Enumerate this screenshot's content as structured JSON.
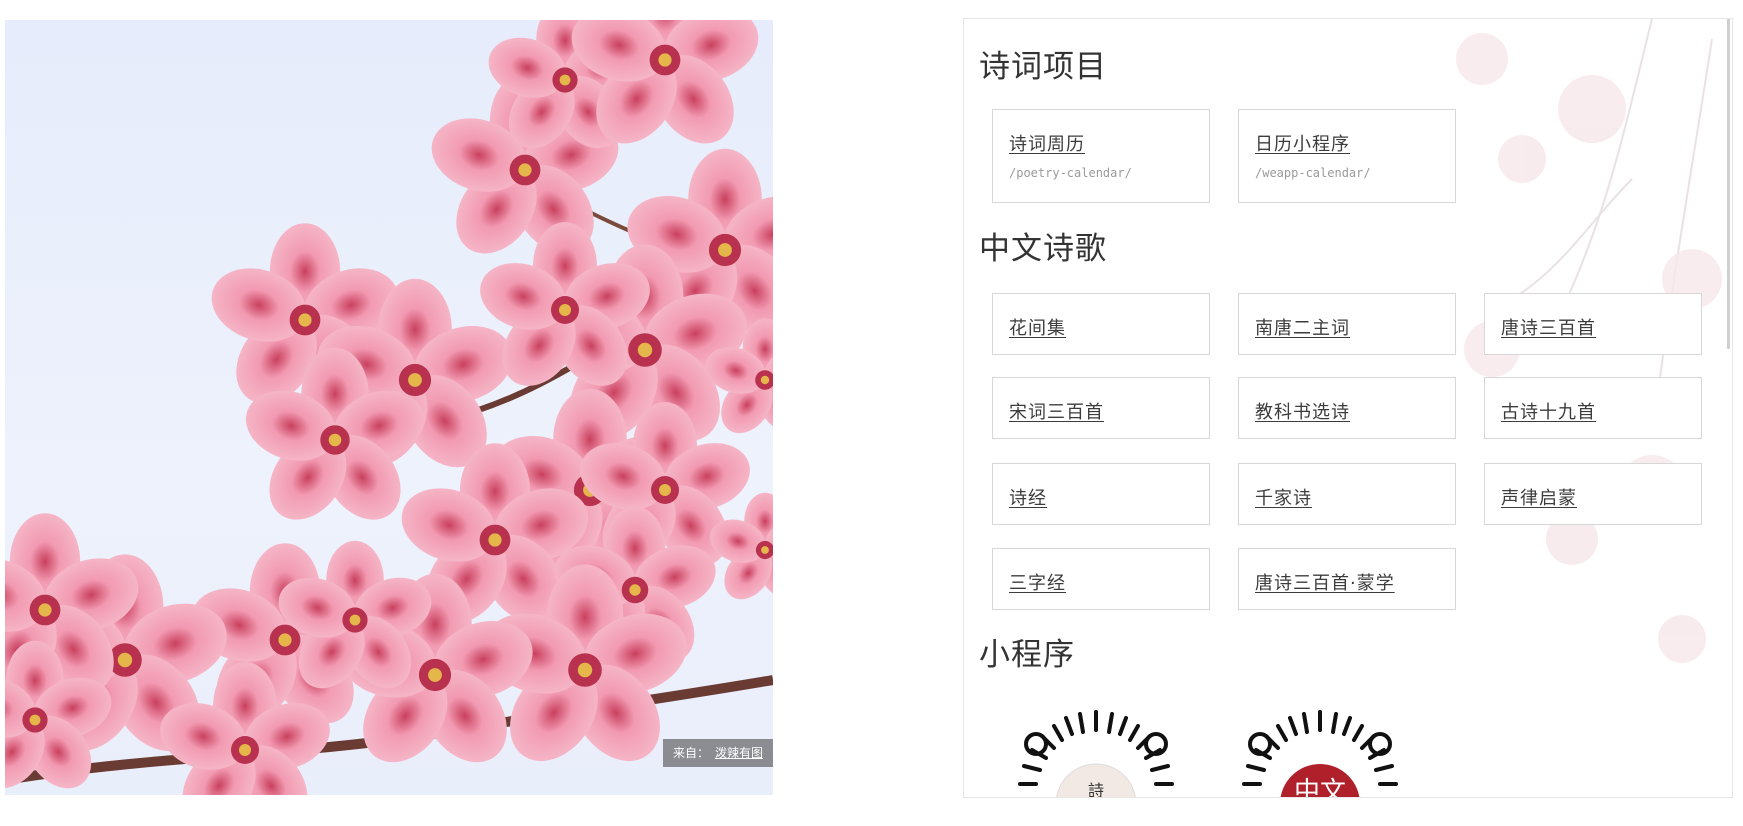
{
  "photo": {
    "credit_prefix": "来自：",
    "credit_link": "泼辣有图"
  },
  "sections": {
    "projects": {
      "title": "诗词项目",
      "items": [
        {
          "label": "诗词周历",
          "path": "/poetry-calendar/"
        },
        {
          "label": "日历小程序",
          "path": "/weapp-calendar/"
        }
      ]
    },
    "poems": {
      "title": "中文诗歌",
      "items": [
        {
          "label": "花间集"
        },
        {
          "label": "南唐二主词"
        },
        {
          "label": "唐诗三百首"
        },
        {
          "label": "宋词三百首"
        },
        {
          "label": "教科书选诗"
        },
        {
          "label": "古诗十九首"
        },
        {
          "label": "诗经"
        },
        {
          "label": "千家诗"
        },
        {
          "label": "声律启蒙"
        },
        {
          "label": "三字经"
        },
        {
          "label": "唐诗三百首·蒙学"
        }
      ]
    },
    "miniprograms": {
      "title": "小程序",
      "qr1_char": "詩",
      "qr2_char": "中文"
    }
  },
  "colors": {
    "petal": "#f08aa5",
    "petal_light": "#f7c1cf",
    "sky": "#e9eefb",
    "qr_red": "#b0202a"
  }
}
